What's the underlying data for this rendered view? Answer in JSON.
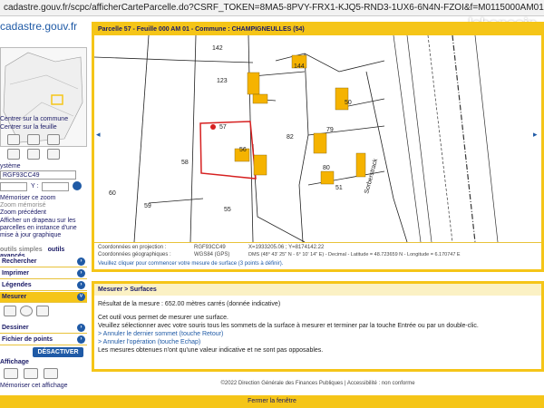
{
  "browser": {
    "url": "cadastre.gouv.fr/scpc/afficherCarteParcelle.do?CSRF_TOKEN=8MA5-8PVY-FRX1-KJQ5-RND3-1UX6-6N4N-FZOI&f=M0115000AM01&p=M0115..."
  },
  "header": {
    "logo": "cadastre.gouv.fr",
    "watermark": "leboncoin"
  },
  "sidebar": {
    "links": [
      "Centrer sur la commune",
      "Centrer sur la feuille"
    ],
    "projection_label": "ystème",
    "projection_value": "RGF93CC49",
    "x_label": "",
    "y_label": "Y :",
    "zoom_links": [
      "Mémoriser ce zoom",
      "Zoom mémorisé",
      "Zoom précédent"
    ],
    "flag_text": "Afficher un drapeau sur les parcelles en instance d'une mise à jour graphique",
    "tabs": [
      "outils simples",
      "outils avancés"
    ],
    "panels": [
      "Rechercher",
      "Imprimer",
      "Légendes",
      "Mesurer"
    ],
    "panels_bottom": [
      "Dessiner",
      "Fichier de points"
    ],
    "deactivate_label": "DÉSACTIVER",
    "display_label": "Affichage",
    "memorize_display": "Mémoriser cet affichage"
  },
  "map": {
    "title": "Parcelle 57 - Feuille 000 AM 01 - Commune : CHAMPIGNEULLES (54)",
    "parcels": [
      "142",
      "144",
      "123",
      "50",
      "79",
      "82",
      "80",
      "56",
      "58",
      "60",
      "59",
      "55",
      "57",
      "51"
    ],
    "street": "Sorberstrack"
  },
  "coords": {
    "proj_label": "Coordonnées en projection :",
    "proj_sys": "RGF93CC49",
    "proj_value": "X=1933205.06 ; Y=8174142.22",
    "geo_label": "Coordonnées géographiques :",
    "geo_sys": "WGS84 (GPS)",
    "geo_value": "DMS (48° 43' 25\" N - 6° 10' 14\" E) - Decimal - Latitude = 48.723659 N - Longitude = 6.170747 E",
    "instruction": "Veuillez cliquer pour commencer votre mesure de surface (3 points à définir)."
  },
  "tool": {
    "title": "Mesurer > Surfaces",
    "result": "Résultat de la mesure : 652.00 mètres carrés   (donnée indicative)",
    "line1": "Cet outil vous permet de mesurer une surface.",
    "line2": "Veuillez sélectionner avec votre souris tous les sommets de la surface à mesurer et terminer par la touche Entrée ou par un double-clic.",
    "line3": "> Annuler le dernier sommet (touche Retour)",
    "line4": "> Annuler l'opération (touche Echap)",
    "line5": "Les mesures obtenues n'ont qu'une valeur indicative et ne sont pas opposables."
  },
  "footer": {
    "text": "©2022 Direction Générale des Finances Publiques  |  Accessibilité : non conforme",
    "close": "Fermer la fenêtre"
  }
}
